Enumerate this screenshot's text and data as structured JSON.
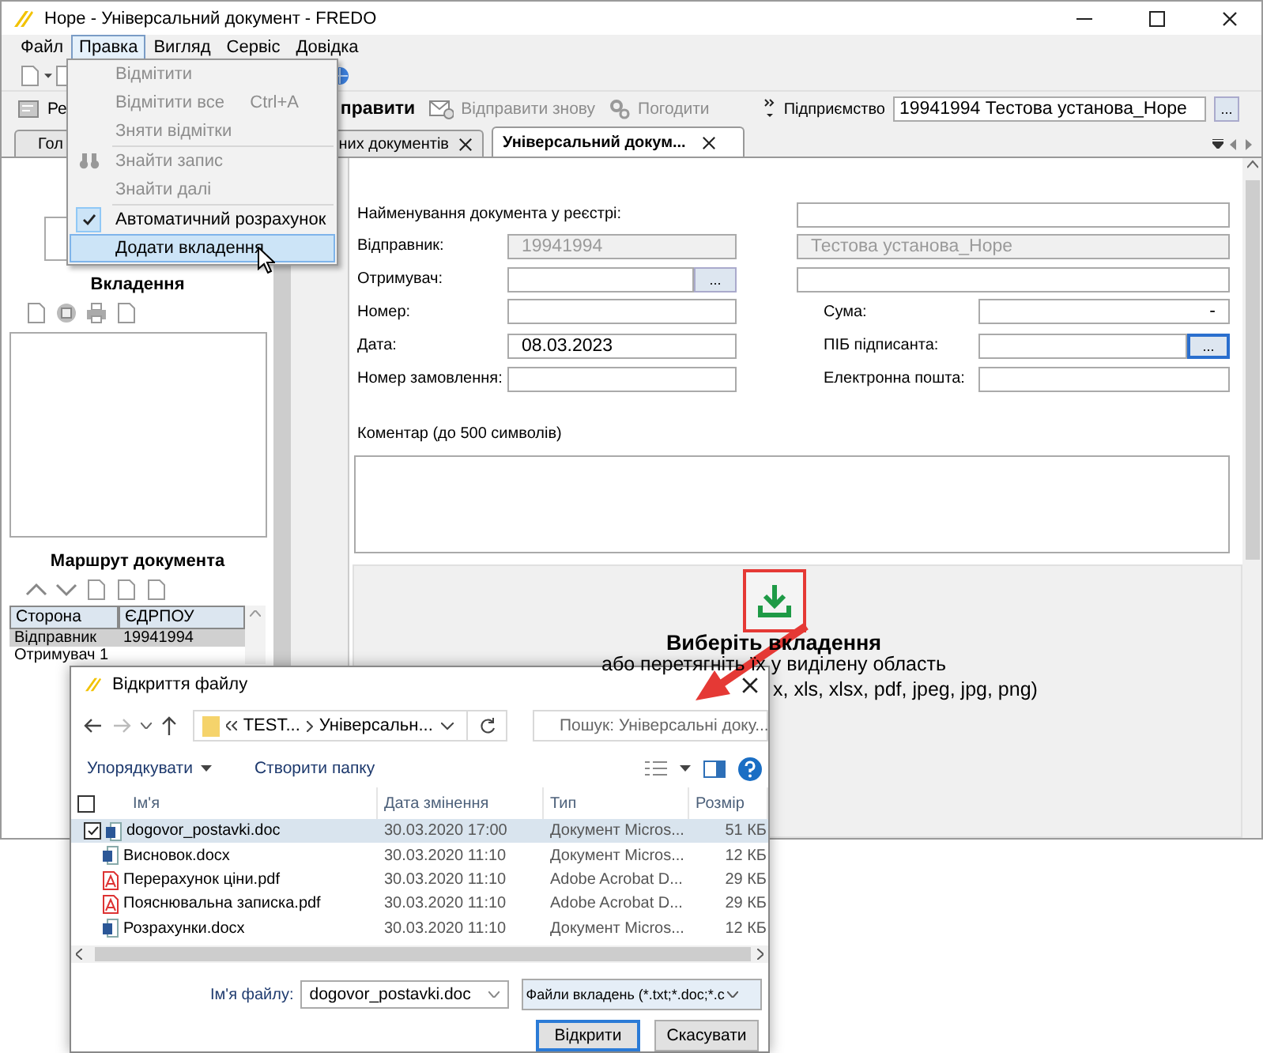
{
  "window": {
    "title": "Hope - Універсальний документ - FREDO"
  },
  "menu_bar": [
    {
      "label": "Файл",
      "selected": false
    },
    {
      "label": "Правка",
      "selected": true
    },
    {
      "label": "Вигляд",
      "selected": false
    },
    {
      "label": "Сервіс",
      "selected": false
    },
    {
      "label": "Довідка",
      "selected": false
    }
  ],
  "edit_menu": [
    {
      "kind": "item",
      "label": "Відмітити",
      "disabled": true,
      "checked": false,
      "selected": false
    },
    {
      "kind": "item",
      "label": "Відмітити все",
      "shortcut": "Ctrl+A",
      "disabled": true,
      "checked": false,
      "selected": false
    },
    {
      "kind": "item",
      "label": "Зняти відмітки",
      "disabled": true,
      "checked": false,
      "selected": false
    },
    {
      "kind": "separator"
    },
    {
      "kind": "find",
      "label": "Знайти запис",
      "disabled": true,
      "checked": false,
      "selected": false
    },
    {
      "kind": "item",
      "label": "Знайти далі",
      "disabled": true,
      "checked": false,
      "selected": false
    },
    {
      "kind": "separator"
    },
    {
      "kind": "item",
      "label": "Автоматичний розрахунок",
      "disabled": false,
      "checked": true,
      "selected": false
    },
    {
      "kind": "item",
      "label": "Додати вкладення",
      "disabled": false,
      "checked": false,
      "selected": true
    }
  ],
  "toolbar": [
    {
      "kind": "edit",
      "label": "Ре",
      "disabled": false
    },
    {
      "kind": "send",
      "label": "правити",
      "disabled": false
    },
    {
      "kind": "resend",
      "label": "Відправити знову",
      "disabled": true
    },
    {
      "kind": "approve",
      "label": "Погодити",
      "disabled": true
    }
  ],
  "enterprise": {
    "label": "Підприємство",
    "value": "19941994  Тестова установа_Hope",
    "button": "..."
  },
  "tabs": [
    {
      "label": "Гол",
      "selected": false
    },
    {
      "label": "них документів",
      "selected": false,
      "closable": true
    },
    {
      "label": "Універсальний докум...",
      "selected": true,
      "closable": true
    }
  ],
  "attachments": {
    "title": "Вкладення"
  },
  "route": {
    "title": "Маршрут документа",
    "columns": [
      "Сторона",
      "ЄДРПОУ"
    ],
    "rows": [
      {
        "cells": [
          "Відправник",
          "19941994"
        ],
        "selected": true
      },
      {
        "cells": [
          "Отримувач 1"
        ],
        "selected": false
      }
    ]
  },
  "form": {
    "registry_name": {
      "label": "Найменування документа у реєстрі:"
    },
    "sender": {
      "label": "Відправник:",
      "code": "19941994",
      "name": "Тестова установа_Hope",
      "disabled": true
    },
    "recipient": {
      "label": "Отримувач:",
      "button": "..."
    },
    "number": {
      "label": "Номер:"
    },
    "sum": {
      "label": "Сума:",
      "value": "-"
    },
    "date": {
      "label": "Дата:",
      "value": "08.03.2023"
    },
    "signer": {
      "label": "ПІБ підписанта:",
      "button": "..."
    },
    "order_number": {
      "label": "Номер замовлення:"
    },
    "email": {
      "label": "Електронна пошта:"
    },
    "comment": {
      "label": "Коментар (до 500 символів)"
    }
  },
  "drop_zone": {
    "title": "Виберіть вкладення",
    "hint": "або перетягніть їх у виділену область",
    "formats": "x, xls, xlsx, pdf, jpeg, jpg, png)"
  },
  "dialog": {
    "title": "Відкриття файлу",
    "path": [
      "TEST...",
      "Універсальн..."
    ],
    "search": {
      "placeholder": "Пошук: Універсальні доку..."
    },
    "organize": "Упорядкувати",
    "new_folder": "Створити папку",
    "header_checkbox": {
      "checked": false
    },
    "columns": [
      "Ім'я",
      "Дата змінення",
      "Тип",
      "Розмір"
    ],
    "files": [
      {
        "kind": "word",
        "name": "dogovor_postavki.doc",
        "modified": "30.03.2020 17:00",
        "type": "Документ Micros...",
        "size": "51 КБ",
        "selected": true,
        "checked": true
      },
      {
        "kind": "word",
        "name": "Висновок.docx",
        "modified": "30.03.2020 11:10",
        "type": "Документ Micros...",
        "size": "12 КБ",
        "selected": false,
        "checked": false
      },
      {
        "kind": "pdf",
        "name": "Перерахунок ціни.pdf",
        "modified": "30.03.2020 11:10",
        "type": "Adobe Acrobat D...",
        "size": "29 КБ",
        "selected": false,
        "checked": false
      },
      {
        "kind": "pdf",
        "name": "Пояснювальна записка.pdf",
        "modified": "30.03.2020 11:10",
        "type": "Adobe Acrobat D...",
        "size": "29 КБ",
        "selected": false,
        "checked": false
      },
      {
        "kind": "word",
        "name": "Розрахунки.docx",
        "modified": "30.03.2020 11:10",
        "type": "Документ Micros...",
        "size": "12 КБ",
        "selected": false,
        "checked": false
      }
    ],
    "file_name": {
      "label": "Ім'я файлу:",
      "value": "dogovor_postavki.doc"
    },
    "filter": "Файли вкладень (*.txt;*.doc;*.c",
    "buttons": [
      {
        "label": "Відкрити",
        "default": true
      },
      {
        "label": "Скасувати",
        "default": false
      }
    ]
  }
}
